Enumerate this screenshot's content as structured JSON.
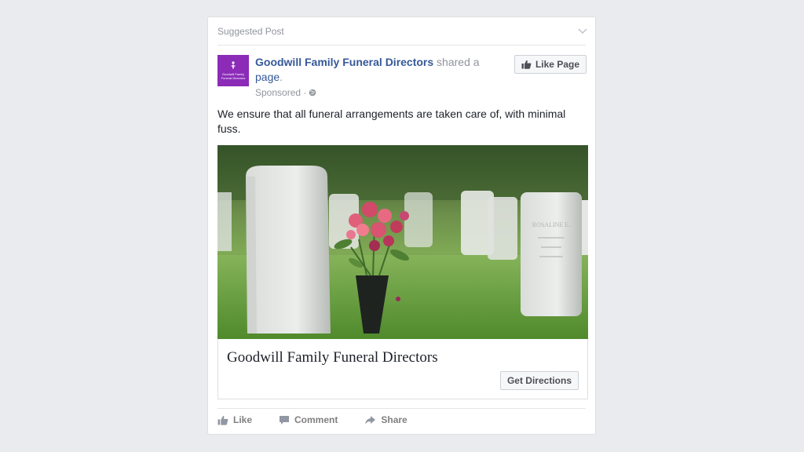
{
  "post": {
    "header_label": "Suggested Post",
    "page_name": "Goodwill Family Funeral Directors",
    "shared_text": " shared a",
    "shared_link": "page",
    "shared_end": ".",
    "sponsored": "Sponsored ·",
    "like_page_label": "Like Page",
    "body_text": "We ensure that all funeral arrangements are taken care of, with minimal fuss."
  },
  "avatar": {
    "line1": "Goodwill Family",
    "line2": "Funeral Directors"
  },
  "link_preview": {
    "title": "Goodwill Family Funeral Directors",
    "cta_label": "Get Directions",
    "headstone_text": "ROSALINE E."
  },
  "actions": {
    "like": "Like",
    "comment": "Comment",
    "share": "Share"
  },
  "colors": {
    "link": "#365899",
    "avatar_bg": "#8b2bb8",
    "muted": "#90949c"
  }
}
